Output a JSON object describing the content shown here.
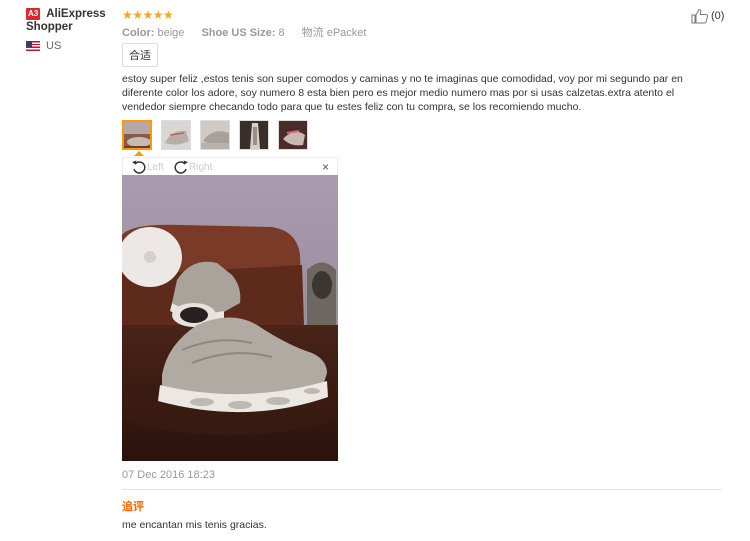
{
  "reviewer": {
    "badge": "A3",
    "name": "AliExpress Shopper",
    "country": "US",
    "flag_icon": "us-flag-icon"
  },
  "rating": {
    "stars": "★★★★★",
    "value": 5,
    "max": 5
  },
  "attributes": {
    "color_label": "Color:",
    "color_value": "beige",
    "size_label": "Shoe US Size:",
    "size_value": "8",
    "shipping_label": "物流",
    "shipping_value": "ePacket"
  },
  "fit_tag": "合适",
  "helpful": {
    "count": "(0)",
    "icon": "thumbs-up-icon"
  },
  "review_text": "estoy super feliz ,estos tenis son super comodos y caminas y no te imaginas que comodidad, voy por mi segundo par en diferente color los adore, soy numero 8 esta bien pero es mejor medio numero mas por si usas calzetas.extra atento el vendedor siempre checando todo para que tu estes feliz con tu compra, se los recomiendo mucho.",
  "thumbnails_count": 5,
  "viewer": {
    "rotate_left": "Left",
    "rotate_right": "Right",
    "close": "×"
  },
  "date": "07 Dec 2016 18:23",
  "seller_reply": {
    "title": "追评",
    "text": "me encantan mis tenis gracias."
  },
  "colors": {
    "star": "#f5a623",
    "accent": "#ff6600",
    "active_thumb_border": "#ff9900",
    "badge": "#d9292b"
  }
}
